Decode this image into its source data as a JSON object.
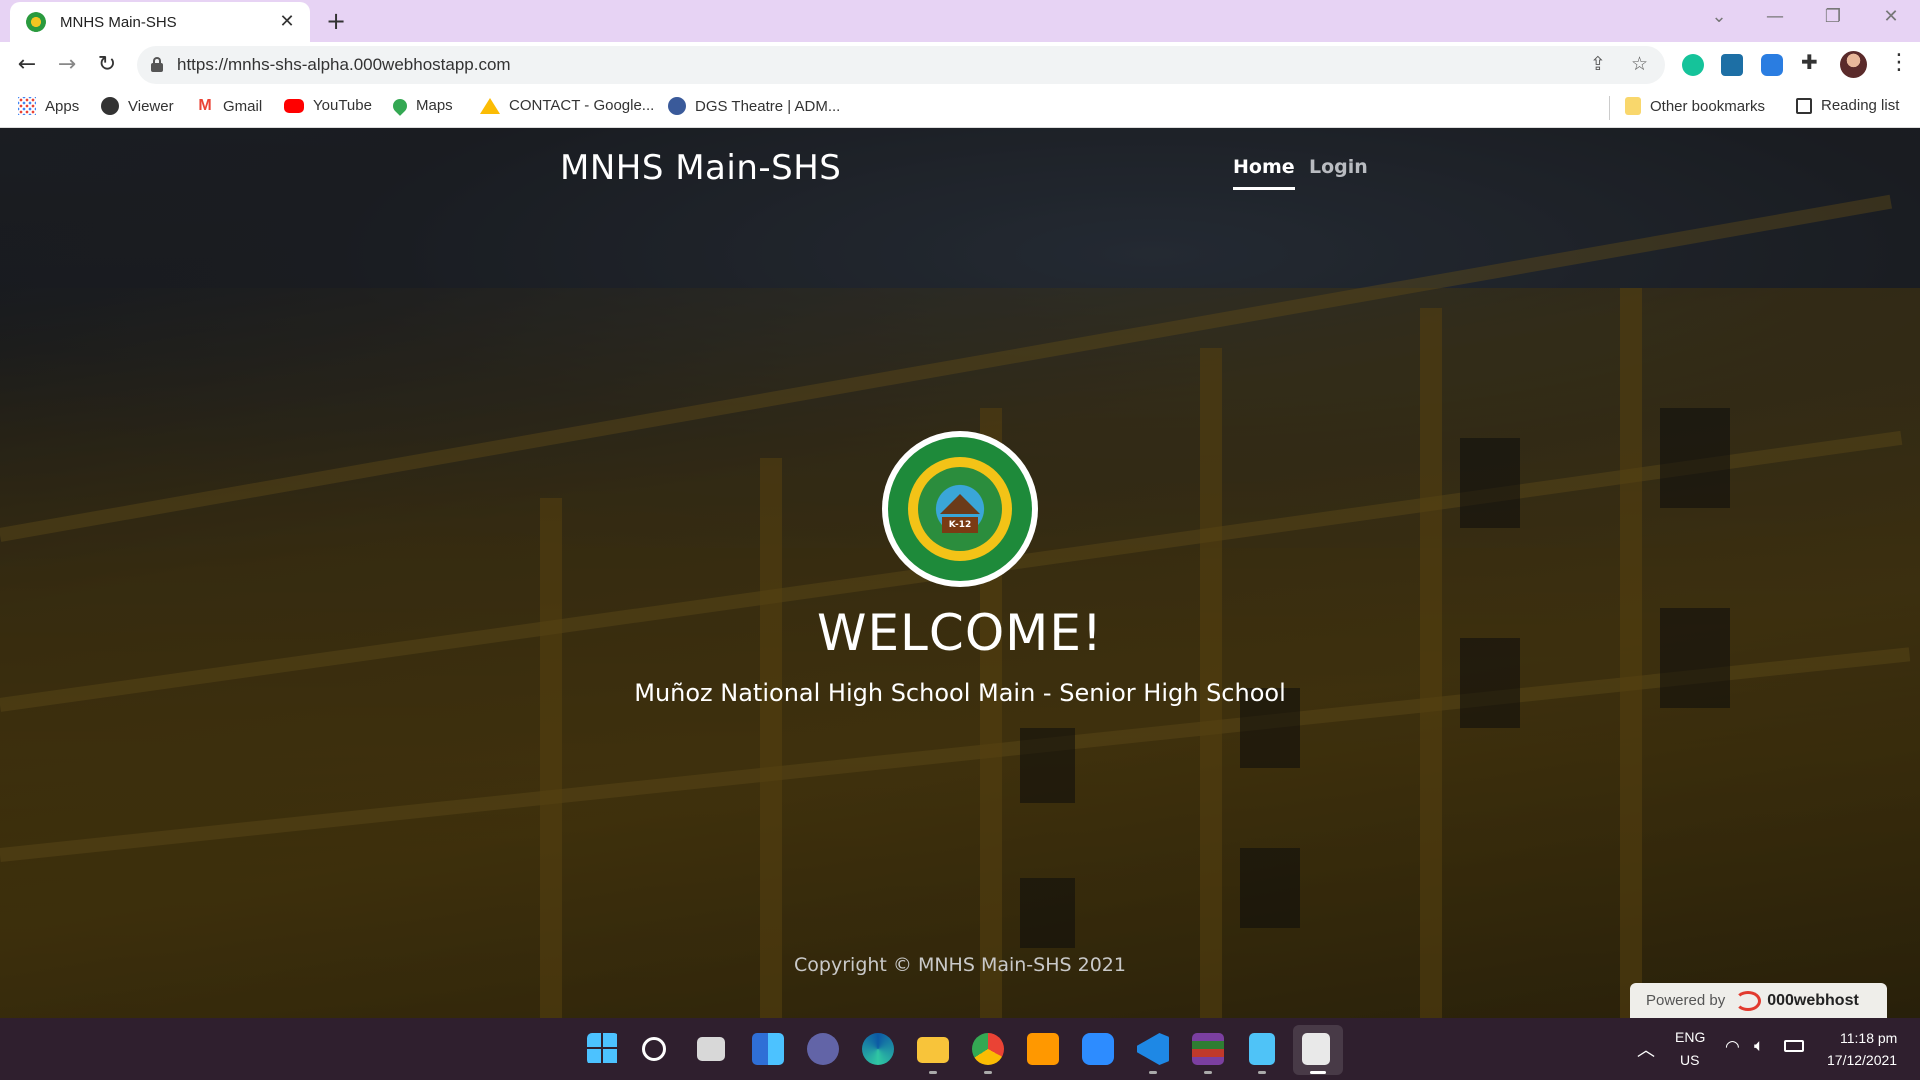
{
  "browser": {
    "tab_title": "MNHS Main-SHS",
    "tab_close": "✕",
    "new_tab": "+",
    "url": "https://mnhs-shs-alpha.000webhostapp.com",
    "bookmarks": [
      {
        "label": "Apps",
        "icon": "apps-grid-icon",
        "color": "#4285f4"
      },
      {
        "label": "Viewer",
        "icon": "globe-icon",
        "color": "#333333"
      },
      {
        "label": "Gmail",
        "icon": "gmail-icon",
        "color": "#ea4335"
      },
      {
        "label": "YouTube",
        "icon": "youtube-icon",
        "color": "#ff0000"
      },
      {
        "label": "Maps",
        "icon": "maps-pin-icon",
        "color": "#34a853"
      },
      {
        "label": "CONTACT - Google...",
        "icon": "google-drive-icon",
        "color": "#fbbc04"
      },
      {
        "label": "DGS Theatre | ADM...",
        "icon": "dgs-theatre-icon",
        "color": "#3a5a9a"
      }
    ],
    "other_bookmarks": "Other bookmarks",
    "reading_list": "Reading list"
  },
  "page": {
    "brand": "MNHS Main-SHS",
    "nav": {
      "home": "Home",
      "login": "Login"
    },
    "logo_text": "K-12",
    "welcome": "WELCOME!",
    "subtitle": "Muñoz National High School Main - Senior High School",
    "copyright": "Copyright © MNHS Main-SHS 2021",
    "powered_by": "Powered by",
    "host_name": "000webhost"
  },
  "taskbar": {
    "apps": [
      "windows-start-icon",
      "search-icon",
      "task-view-icon",
      "widgets-icon",
      "teams-chat-icon",
      "edge-icon",
      "file-explorer-icon",
      "chrome-icon",
      "sublime-text-icon",
      "zoom-icon",
      "vscode-icon",
      "winrar-icon",
      "notepad-icon",
      "snipping-tool-icon"
    ],
    "language": "ENG",
    "region": "US",
    "time": "11:18 pm",
    "date": "17/12/2021"
  }
}
